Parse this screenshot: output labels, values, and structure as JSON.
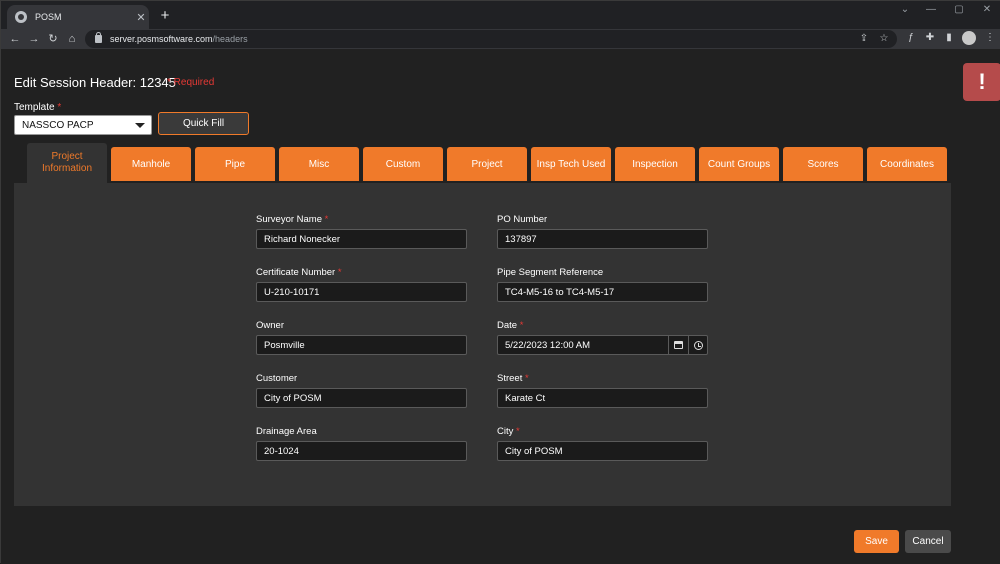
{
  "browser": {
    "tab_title": "POSM",
    "tab_close": "✕",
    "new_tab": "+",
    "url_host": "server.posmsoftware.com",
    "url_path": "/headers",
    "window_controls": [
      "⌄",
      "—",
      "▢",
      "✕"
    ]
  },
  "header": {
    "title": "Edit Session Header: 12345",
    "required_note": "* Required",
    "alert_icon": "!"
  },
  "template": {
    "label": "Template",
    "required_mark": "*",
    "selected": "NASSCO PACP",
    "quick_fill_label": "Quick Fill"
  },
  "tabs": [
    {
      "label": "Project\nInformation",
      "active": true
    },
    {
      "label": "Manhole"
    },
    {
      "label": "Pipe"
    },
    {
      "label": "Misc"
    },
    {
      "label": "Custom"
    },
    {
      "label": "Project"
    },
    {
      "label": "Insp Tech Used"
    },
    {
      "label": "Inspection"
    },
    {
      "label": "Count Groups"
    },
    {
      "label": "Scores"
    },
    {
      "label": "Coordinates"
    }
  ],
  "form": {
    "surveyor_name": {
      "label": "Surveyor Name",
      "required": "*",
      "value": "Richard Nonecker"
    },
    "certificate_number": {
      "label": "Certificate Number",
      "required": "*",
      "value": "U-210-10171"
    },
    "owner": {
      "label": "Owner",
      "value": "Posmville"
    },
    "customer": {
      "label": "Customer",
      "value": "City of POSM"
    },
    "drainage_area": {
      "label": "Drainage Area",
      "value": "20-1024"
    },
    "po_number": {
      "label": "PO Number",
      "value": "137897"
    },
    "pipe_segment_reference": {
      "label": "Pipe Segment Reference",
      "value": "TC4-M5-16 to TC4-M5-17"
    },
    "date": {
      "label": "Date",
      "required": "*",
      "value": "5/22/2023 12:00 AM"
    },
    "street": {
      "label": "Street",
      "required": "*",
      "value": "Karate Ct"
    },
    "city": {
      "label": "City",
      "required": "*",
      "value": "City of POSM"
    }
  },
  "actions": {
    "save_label": "Save",
    "cancel_label": "Cancel"
  },
  "colors": {
    "accent": "#f07a2a",
    "required": "#e53935",
    "alert": "#b54b4b"
  }
}
